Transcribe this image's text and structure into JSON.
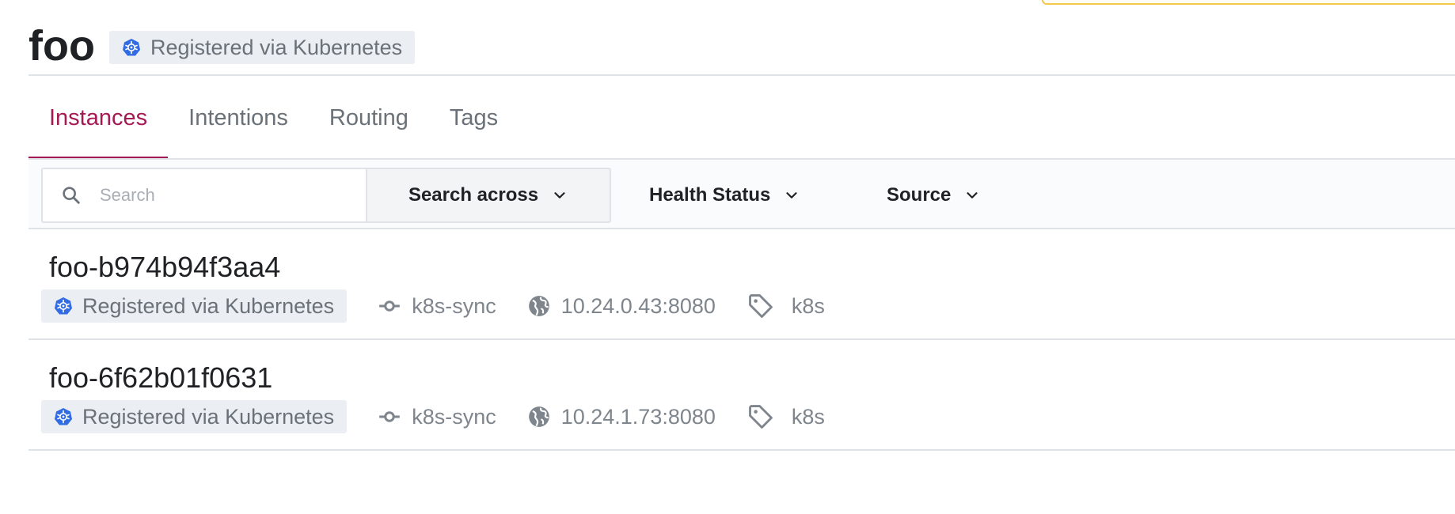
{
  "header": {
    "title": "foo",
    "badge_label": "Registered via Kubernetes"
  },
  "tabs": [
    {
      "label": "Instances",
      "active": true
    },
    {
      "label": "Intentions",
      "active": false
    },
    {
      "label": "Routing",
      "active": false
    },
    {
      "label": "Tags",
      "active": false
    }
  ],
  "filters": {
    "search_placeholder": "Search",
    "search_value": "",
    "search_across_label": "Search across",
    "health_status_label": "Health Status",
    "source_label": "Source"
  },
  "instances": [
    {
      "name": "foo-b974b94f3aa4",
      "source_badge": "Registered via Kubernetes",
      "node": "k8s-sync",
      "address": "10.24.0.43:8080",
      "tag": "k8s"
    },
    {
      "name": "foo-6f62b01f0631",
      "source_badge": "Registered via Kubernetes",
      "node": "k8s-sync",
      "address": "10.24.1.73:8080",
      "tag": "k8s"
    }
  ],
  "colors": {
    "accent": "#a51a55",
    "kubernetes_blue": "#326ce5",
    "badge_bg": "#ebeef2",
    "notice_border": "#f2c94c"
  }
}
